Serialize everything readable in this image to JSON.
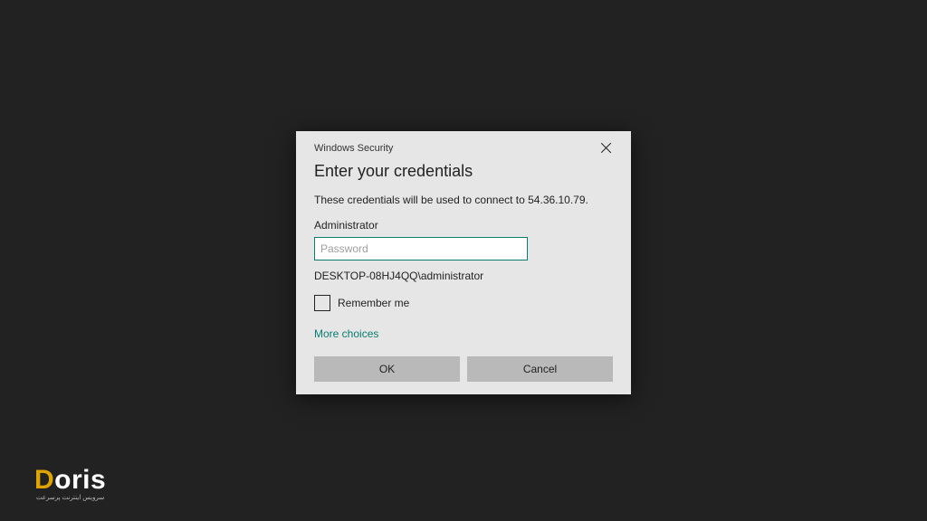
{
  "dialog": {
    "window_title": "Windows Security",
    "heading": "Enter your credentials",
    "description": "These credentials will be used to connect to 54.36.10.79.",
    "username_label": "Administrator",
    "password_placeholder": "Password",
    "domain_user": "DESKTOP-08HJ4QQ\\administrator",
    "remember_label": "Remember me",
    "more_choices_label": "More choices",
    "ok_label": "OK",
    "cancel_label": "Cancel"
  },
  "branding": {
    "logo_text_prefix": "D",
    "logo_text_rest": "oris",
    "tagline": "سرویس اینترنت پرسرعت"
  },
  "colors": {
    "dialog_bg": "#e6e6e6",
    "accent": "#0a7d6f",
    "desktop": "#222222",
    "button_bg": "#b9b9b9",
    "logo_accent": "#e0a400"
  }
}
